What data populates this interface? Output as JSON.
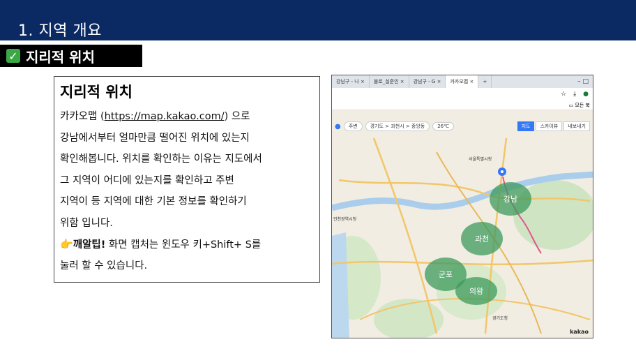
{
  "header": {
    "title": "1. 지역 개요",
    "bg_color": "#0b2a63"
  },
  "section": {
    "check_icon": "check-mark-icon",
    "label": "지리적 위치"
  },
  "textbox": {
    "title": "지리적 위치",
    "para_prefix": "카카오맵 (",
    "link": "https://map.kakao.com/",
    "para_after_link": ") 으로",
    "lines": [
      "강남에서부터 얼마만큼 떨어진 위치에 있는지",
      "확인해봅니다. 위치를 확인하는 이유는 지도에서",
      "그 지역이 어디에 있는지를 확인하고 주변",
      "지역이 등 지역에 대한 기본 정보를 확인하기",
      "위함 입니다."
    ],
    "tip_icon": "pointing-hand-icon",
    "tip_label": "깨알팁!",
    "tip_text": " 화면 캡처는 윈도우 키+Shift+ S를",
    "tip_text2": "눌러 할 수 있습니다."
  },
  "browser": {
    "tabs": [
      "강남구 - 나",
      "블로_실준인",
      "강남구 - G",
      "카카오맵"
    ],
    "window_controls": "–   □",
    "address_icons": [
      "☆",
      "⤓",
      "●"
    ],
    "bookmark": "모든 북"
  },
  "map_toolbar": {
    "home": "주변",
    "breadcrumb": "경기도  >  과천시  >  중앙동",
    "weather": "26℃",
    "buttons": [
      "지도",
      "스카이뷰"
    ],
    "right": "내보내기"
  },
  "map": {
    "regions": [
      {
        "label": "강남"
      },
      {
        "label": "과천"
      },
      {
        "label": "군포"
      },
      {
        "label": "의왕"
      }
    ],
    "city_labels": [
      "서울특별시청",
      "인천광역시청",
      "경기도청"
    ],
    "brand": "kakao",
    "region_color": "#3e9a5c"
  }
}
